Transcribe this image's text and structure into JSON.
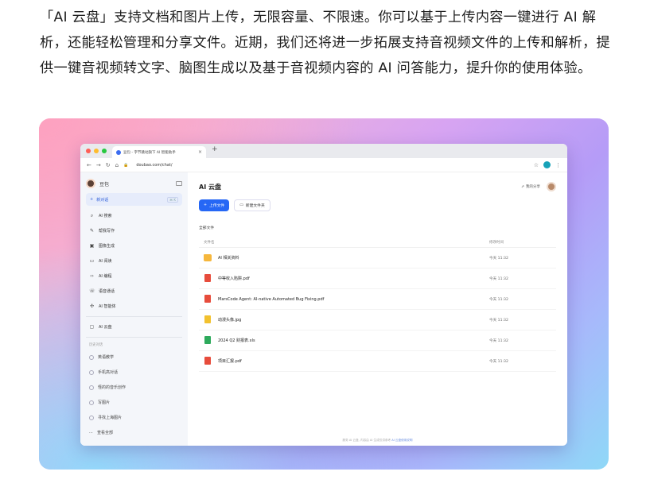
{
  "intro_text": "「AI 云盘」支持文档和图片上传，无限容量、不限速。你可以基于上传内容一键进行 AI 解析，还能轻松管理和分享文件。近期，我们还将进一步拓展支持音视频文件的上传和解析，提供一键音视频转文字、脑图生成以及基于音视频内容的 AI 问答能力，提升你的使用体验。",
  "browser": {
    "tab_title": "豆包 - 字节跳动旗下 AI 智能助手",
    "url": "doubao.com/chat/"
  },
  "sidebar": {
    "app_name": "豆包",
    "new_chat": {
      "label": "新对话",
      "shortcut": "⌘ K"
    },
    "items": [
      {
        "label": "AI 搜索",
        "icon": "search-icon"
      },
      {
        "label": "帮我写作",
        "icon": "pen-icon"
      },
      {
        "label": "图像生成",
        "icon": "image-icon"
      },
      {
        "label": "AI 阅读",
        "icon": "book-icon"
      },
      {
        "label": "AI 编程",
        "icon": "code-icon"
      },
      {
        "label": "语音通话",
        "icon": "phone-icon"
      },
      {
        "label": "AI 智能体",
        "icon": "agent-icon"
      }
    ],
    "cloud_item": {
      "label": "AI 云盘",
      "icon": "cloud-icon"
    },
    "history_label": "历史对话",
    "history": [
      "英语教学",
      "手机高对话",
      "怪的的音乐创作",
      "写图片",
      "寻找上海图片"
    ],
    "more": "查看全部"
  },
  "main": {
    "title": "AI 云盘",
    "share": "我的分享",
    "upload_btn": "上传文件",
    "new_folder_btn": "新建文件夹",
    "all_files": "全部文件",
    "col_name": "文件名",
    "col_time": "修改时间",
    "files": [
      {
        "name": "AI 相关资料",
        "type": "folder",
        "time": "今天 11:32"
      },
      {
        "name": "中等收入陷阱.pdf",
        "type": "pdf",
        "time": "今天 11:32"
      },
      {
        "name": "MarsCode Agent: AI-native Automated Bug Fixing.pdf",
        "type": "pdf",
        "time": "今天 11:32"
      },
      {
        "name": "动漫头像.jpg",
        "type": "jpg",
        "time": "今天 11:32"
      },
      {
        "name": "2024 Q2 财报表.xls",
        "type": "xls",
        "time": "今天 11:32"
      },
      {
        "name": "项目汇报.pdf",
        "type": "pdf",
        "time": "今天 11:32"
      }
    ],
    "footer_text": "服务 AI 云盘, 内容由 AI 生成仅供参考",
    "footer_link": "AI 云盘使用说明"
  }
}
